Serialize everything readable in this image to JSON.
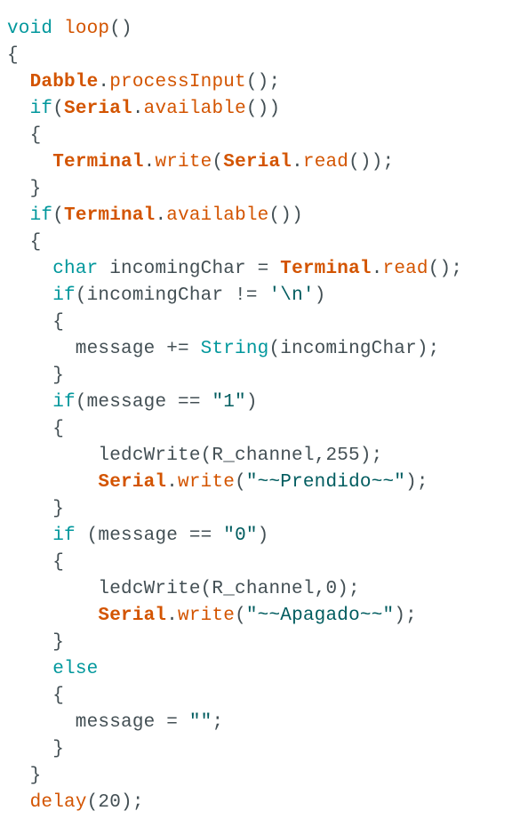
{
  "colors": {
    "background": "#ffffff",
    "plain": "#434f54",
    "keyword": "#00979c",
    "function": "#d35400",
    "class": "#d35400",
    "string": "#005c5f"
  },
  "code": {
    "lines": [
      [
        {
          "k": "kw",
          "t": "void"
        },
        {
          "k": "p",
          "t": " "
        },
        {
          "k": "fn",
          "t": "loop"
        },
        {
          "k": "p",
          "t": "()"
        }
      ],
      [
        {
          "k": "p",
          "t": "{"
        }
      ],
      [
        {
          "k": "p",
          "t": "  "
        },
        {
          "k": "cls",
          "t": "Dabble"
        },
        {
          "k": "p",
          "t": "."
        },
        {
          "k": "fn",
          "t": "processInput"
        },
        {
          "k": "p",
          "t": "();"
        }
      ],
      [
        {
          "k": "p",
          "t": "  "
        },
        {
          "k": "kw",
          "t": "if"
        },
        {
          "k": "p",
          "t": "("
        },
        {
          "k": "cls",
          "t": "Serial"
        },
        {
          "k": "p",
          "t": "."
        },
        {
          "k": "fn",
          "t": "available"
        },
        {
          "k": "p",
          "t": "())"
        }
      ],
      [
        {
          "k": "p",
          "t": "  {"
        }
      ],
      [
        {
          "k": "p",
          "t": "    "
        },
        {
          "k": "cls",
          "t": "Terminal"
        },
        {
          "k": "p",
          "t": "."
        },
        {
          "k": "fn",
          "t": "write"
        },
        {
          "k": "p",
          "t": "("
        },
        {
          "k": "cls",
          "t": "Serial"
        },
        {
          "k": "p",
          "t": "."
        },
        {
          "k": "fn",
          "t": "read"
        },
        {
          "k": "p",
          "t": "());"
        }
      ],
      [
        {
          "k": "p",
          "t": "  }"
        }
      ],
      [
        {
          "k": "p",
          "t": "  "
        },
        {
          "k": "kw",
          "t": "if"
        },
        {
          "k": "p",
          "t": "("
        },
        {
          "k": "cls",
          "t": "Terminal"
        },
        {
          "k": "p",
          "t": "."
        },
        {
          "k": "fn",
          "t": "available"
        },
        {
          "k": "p",
          "t": "())"
        }
      ],
      [
        {
          "k": "p",
          "t": "  {"
        }
      ],
      [
        {
          "k": "p",
          "t": "    "
        },
        {
          "k": "kw",
          "t": "char"
        },
        {
          "k": "p",
          "t": " incomingChar = "
        },
        {
          "k": "cls",
          "t": "Terminal"
        },
        {
          "k": "p",
          "t": "."
        },
        {
          "k": "fn",
          "t": "read"
        },
        {
          "k": "p",
          "t": "();"
        }
      ],
      [
        {
          "k": "p",
          "t": "    "
        },
        {
          "k": "kw",
          "t": "if"
        },
        {
          "k": "p",
          "t": "(incomingChar != "
        },
        {
          "k": "str",
          "t": "'\\n'"
        },
        {
          "k": "p",
          "t": ")"
        }
      ],
      [
        {
          "k": "p",
          "t": "    {"
        }
      ],
      [
        {
          "k": "p",
          "t": "      message += "
        },
        {
          "k": "kw",
          "t": "String"
        },
        {
          "k": "p",
          "t": "(incomingChar);"
        }
      ],
      [
        {
          "k": "p",
          "t": "    }"
        }
      ],
      [
        {
          "k": "p",
          "t": "    "
        },
        {
          "k": "kw",
          "t": "if"
        },
        {
          "k": "p",
          "t": "(message == "
        },
        {
          "k": "str",
          "t": "\"1\""
        },
        {
          "k": "p",
          "t": ")"
        }
      ],
      [
        {
          "k": "p",
          "t": "    {"
        }
      ],
      [
        {
          "k": "p",
          "t": "        ledcWrite(R_channel,255);"
        }
      ],
      [
        {
          "k": "p",
          "t": "        "
        },
        {
          "k": "cls",
          "t": "Serial"
        },
        {
          "k": "p",
          "t": "."
        },
        {
          "k": "fn",
          "t": "write"
        },
        {
          "k": "p",
          "t": "("
        },
        {
          "k": "str",
          "t": "\"~~Prendido~~\""
        },
        {
          "k": "p",
          "t": ");"
        }
      ],
      [
        {
          "k": "p",
          "t": "    }"
        }
      ],
      [
        {
          "k": "p",
          "t": "    "
        },
        {
          "k": "kw",
          "t": "if"
        },
        {
          "k": "p",
          "t": " (message == "
        },
        {
          "k": "str",
          "t": "\"0\""
        },
        {
          "k": "p",
          "t": ")"
        }
      ],
      [
        {
          "k": "p",
          "t": "    {"
        }
      ],
      [
        {
          "k": "p",
          "t": "        ledcWrite(R_channel,0);"
        }
      ],
      [
        {
          "k": "p",
          "t": "        "
        },
        {
          "k": "cls",
          "t": "Serial"
        },
        {
          "k": "p",
          "t": "."
        },
        {
          "k": "fn",
          "t": "write"
        },
        {
          "k": "p",
          "t": "("
        },
        {
          "k": "str",
          "t": "\"~~Apagado~~\""
        },
        {
          "k": "p",
          "t": ");"
        }
      ],
      [
        {
          "k": "p",
          "t": "    }"
        }
      ],
      [
        {
          "k": "p",
          "t": "    "
        },
        {
          "k": "kw",
          "t": "else"
        }
      ],
      [
        {
          "k": "p",
          "t": "    {"
        }
      ],
      [
        {
          "k": "p",
          "t": "      message = "
        },
        {
          "k": "str",
          "t": "\"\""
        },
        {
          "k": "p",
          "t": ";"
        }
      ],
      [
        {
          "k": "p",
          "t": "    }"
        }
      ],
      [
        {
          "k": "p",
          "t": "  }"
        }
      ],
      [
        {
          "k": "p",
          "t": "  "
        },
        {
          "k": "fn",
          "t": "delay"
        },
        {
          "k": "p",
          "t": "(20);"
        }
      ]
    ]
  }
}
